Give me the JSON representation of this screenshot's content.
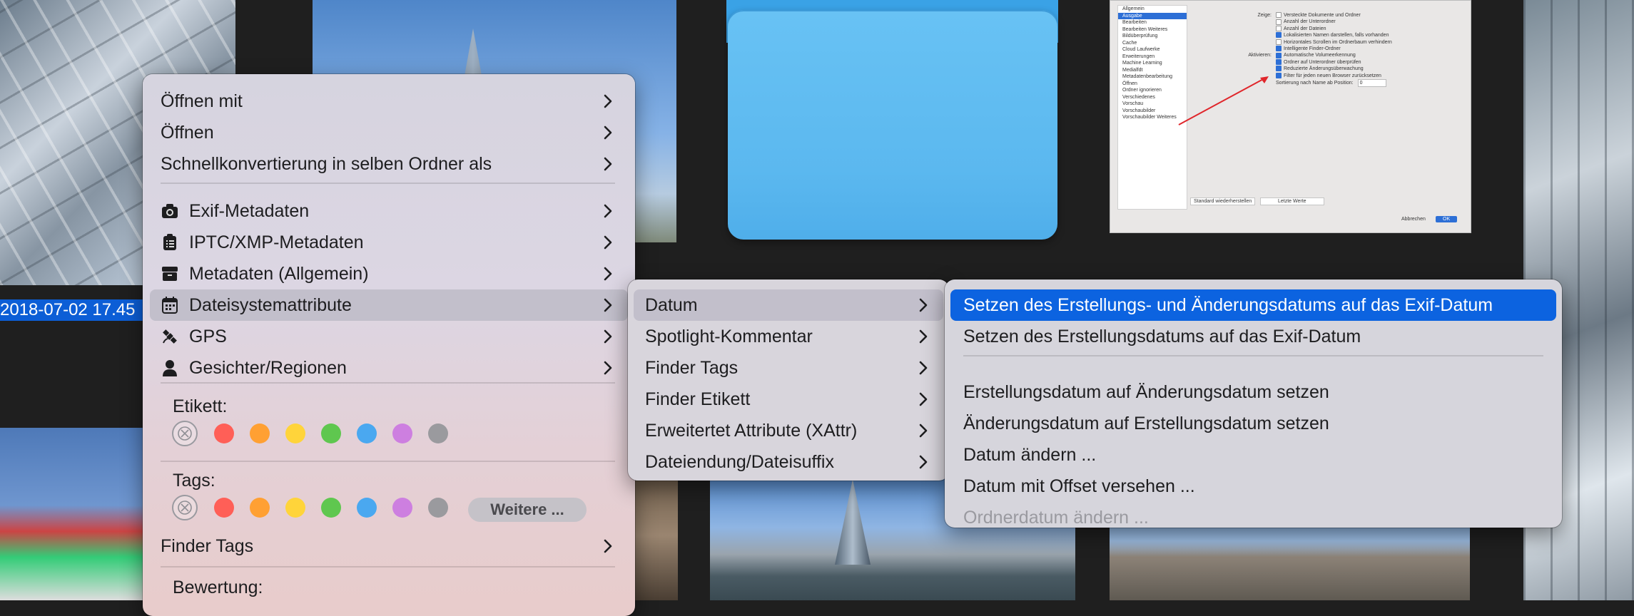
{
  "filename_label": "2018-07-02 17.45",
  "settings_screenshot": {
    "sidebar_items": [
      "Allgemein",
      "Ausgabe",
      "Bearbeiten",
      "Bearbeiten Weiteres",
      "Bildüberprüfung",
      "Cache",
      "Cloud Laufwerke",
      "Erweiterungen",
      "Machine Learning",
      "Medialfdt",
      "Metadatenbearbeitung",
      "Öffnen",
      "Ordner ignorieren",
      "Verschiedenes",
      "Vorschau",
      "Vorschaubilder",
      "Vorschaubilder Weiteres"
    ],
    "active_sidebar_index": 1,
    "rows": [
      {
        "label": "Zeige:",
        "text": "Versteckte Dokumente und Ordner",
        "checked": false
      },
      {
        "label": "",
        "text": "Anzahl der Unterordner",
        "checked": false
      },
      {
        "label": "",
        "text": "Anzahl der Dateien",
        "checked": false
      },
      {
        "label": "",
        "text": "Lokalisierten Namen darstellen, falls vorhanden",
        "checked": true
      },
      {
        "label": "",
        "text": "Horizontales Scrollen im Ordnerbaum verhindern",
        "checked": false
      },
      {
        "label": "",
        "text": "Intelligente Finder-Ordner",
        "checked": true
      },
      {
        "label": "Aktivieren:",
        "text": "Automatische Volumeerkennung",
        "checked": true
      },
      {
        "label": "",
        "text": "Ordner auf Unterordner überprüfen",
        "checked": true
      },
      {
        "label": "",
        "text": "Reduzierte Änderungsüberwachung",
        "checked": true
      },
      {
        "label": "",
        "text": "Filter für jeden neuen Browser zurücksetzen",
        "checked": true
      },
      {
        "label": "",
        "text": "Sortierung nach Name ab Position:",
        "checked": null
      }
    ],
    "position_value": "0",
    "btn_standard": "Standard wiederherstellen",
    "btn_last": "Letzte Werte",
    "btn_cancel": "Abbrechen",
    "btn_ok": "OK"
  },
  "main_menu": {
    "items": [
      {
        "label": "Öffnen mit",
        "icon": "",
        "submenu": true
      },
      {
        "label": "Öffnen",
        "icon": "",
        "submenu": true
      },
      {
        "label": "Schnellkonvertierung in selben Ordner als",
        "icon": "",
        "submenu": true
      },
      {
        "label": "Exif-Metadaten",
        "icon": "camera-icon",
        "submenu": true
      },
      {
        "label": "IPTC/XMP-Metadaten",
        "icon": "clipboard-icon",
        "submenu": true
      },
      {
        "label": "Metadaten (Allgemein)",
        "icon": "box-icon",
        "submenu": true
      },
      {
        "label": "Dateisystemattribute",
        "icon": "calendar-icon",
        "submenu": true
      },
      {
        "label": "GPS",
        "icon": "satellite-icon",
        "submenu": true
      },
      {
        "label": "Gesichter/Regionen",
        "icon": "person-icon",
        "submenu": true
      }
    ],
    "etikett_label": "Etikett:",
    "tags_label": "Tags:",
    "weitere_label": "Weitere ...",
    "finder_tags_label": "Finder Tags",
    "bewertung_label": "Bewertung:",
    "color_dots": [
      "#ff5f57",
      "#ffa033",
      "#ffd43a",
      "#5fc74f",
      "#4aa8f0",
      "#cd7fe0",
      "#9a9a9e"
    ]
  },
  "submenu_1": {
    "items": [
      "Datum",
      "Spotlight-Kommentar",
      "Finder Tags",
      "Finder Etikett",
      "Erweitertet Attribute (XAttr)",
      "Dateiendung/Dateisuffix"
    ]
  },
  "submenu_2": {
    "items": [
      "Setzen des Erstellungs- und Änderungsdatums auf das Exif-Datum",
      "Setzen des Erstellungsdatums auf das Exif-Datum",
      "Erstellungsdatum auf Änderungsdatum setzen",
      "Änderungsdatum auf Erstellungsdatum setzen",
      "Datum ändern ...",
      "Datum mit Offset versehen ...",
      "Ordnerdatum ändern ..."
    ]
  },
  "chevron": "›",
  "none_glyph": "⊗"
}
